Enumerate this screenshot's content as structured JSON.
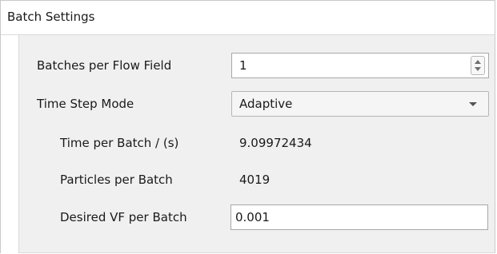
{
  "group": {
    "title": "Batch Settings"
  },
  "rows": {
    "batches_per_flow_field": {
      "label": "Batches per Flow Field",
      "value": "1"
    },
    "time_step_mode": {
      "label": "Time Step Mode",
      "selected": "Adaptive"
    },
    "time_per_batch": {
      "label": "Time per Batch / (s)",
      "value": "9.09972434"
    },
    "particles_per_batch": {
      "label": "Particles per Batch",
      "value": "4019"
    },
    "desired_vf_per_batch": {
      "label": "Desired VF per Batch",
      "value": "0.001"
    }
  },
  "icons": {
    "spinner": "spinner-icon",
    "dropdown": "chevron-down-icon"
  }
}
